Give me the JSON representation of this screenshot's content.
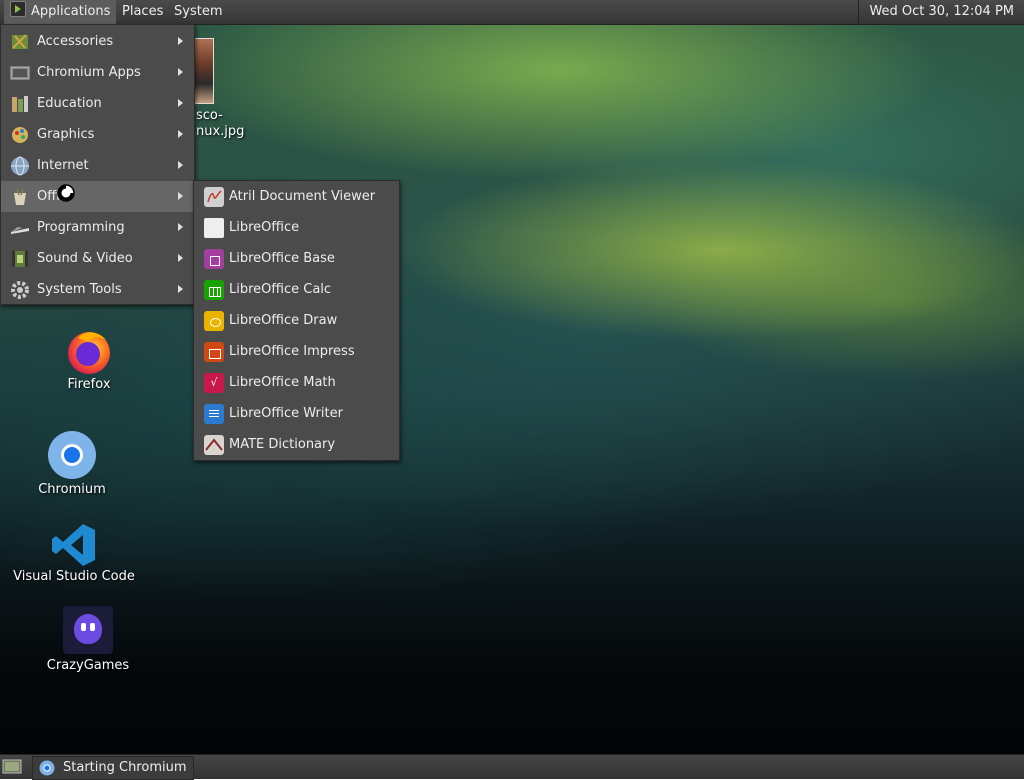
{
  "top_panel": {
    "applications": "Applications",
    "places": "Places",
    "system": "System",
    "clock": "Wed Oct 30, 12:04 PM"
  },
  "app_menu": {
    "items": [
      {
        "label": "Accessories",
        "icon": "accessories-icon"
      },
      {
        "label": "Chromium Apps",
        "icon": "chromium-apps-icon"
      },
      {
        "label": "Education",
        "icon": "education-icon"
      },
      {
        "label": "Graphics",
        "icon": "graphics-icon"
      },
      {
        "label": "Internet",
        "icon": "internet-icon"
      },
      {
        "label": "Offi",
        "icon": "office-icon"
      },
      {
        "label": "Programming",
        "icon": "programming-icon"
      },
      {
        "label": "Sound & Video",
        "icon": "sound-video-icon"
      },
      {
        "label": "System Tools",
        "icon": "system-tools-icon"
      }
    ]
  },
  "office_menu": {
    "items": [
      {
        "label": "Atril Document Viewer",
        "icon": "atril-icon",
        "color": "#c8c8c8"
      },
      {
        "label": "LibreOffice",
        "icon": "libreoffice-icon",
        "color": "#e8e8e8"
      },
      {
        "label": "LibreOffice Base",
        "icon": "libreoffice-base-icon",
        "color": "#a33e9e"
      },
      {
        "label": "LibreOffice Calc",
        "icon": "libreoffice-calc-icon",
        "color": "#18a303"
      },
      {
        "label": "LibreOffice Draw",
        "icon": "libreoffice-draw-icon",
        "color": "#e8b400"
      },
      {
        "label": "LibreOffice Impress",
        "icon": "libreoffice-impress-icon",
        "color": "#d24814"
      },
      {
        "label": "LibreOffice Math",
        "icon": "libreoffice-math-icon",
        "color": "#c9184a"
      },
      {
        "label": "LibreOffice Writer",
        "icon": "libreoffice-writer-icon",
        "color": "#2a7bd0"
      },
      {
        "label": "MATE Dictionary",
        "icon": "mate-dictionary-icon",
        "color": "#d9d4cf"
      }
    ]
  },
  "desktop": {
    "file_label_line1": "sco-",
    "file_label_line2": "nux.jpg",
    "icons": [
      {
        "label": "Firefox",
        "icon": "firefox-icon"
      },
      {
        "label": "Chromium",
        "icon": "chromium-icon"
      },
      {
        "label": "Visual Studio Code",
        "icon": "vscode-icon"
      },
      {
        "label": "CrazyGames",
        "icon": "crazygames-icon"
      }
    ]
  },
  "taskbar": {
    "task_label": "Starting Chromium"
  }
}
